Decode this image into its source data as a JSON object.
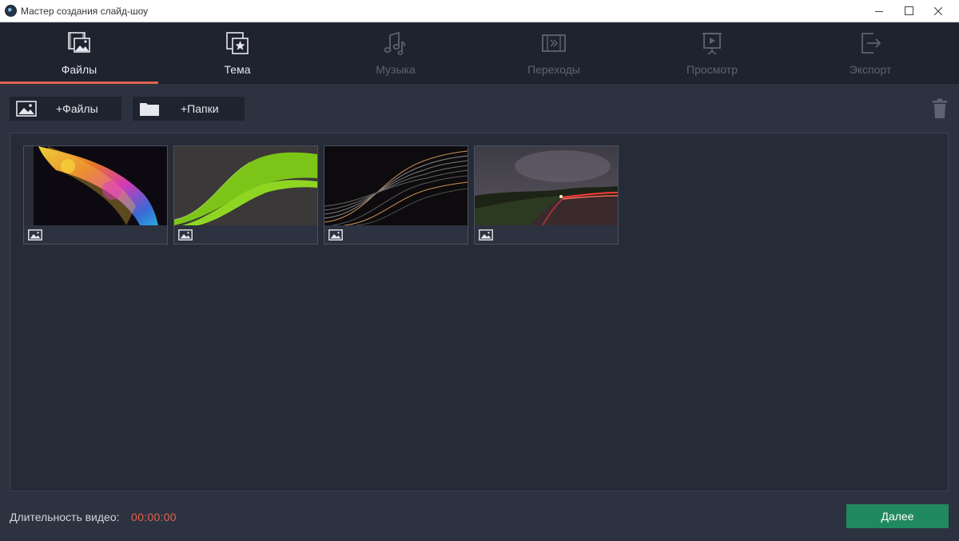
{
  "window": {
    "title": "Мастер создания слайд-шоу",
    "close_glyph": "✕"
  },
  "tabs": [
    {
      "label": "Файлы",
      "icon": "film-image-icon",
      "state": "active"
    },
    {
      "label": "Тема",
      "icon": "theme-star-icon",
      "state": "enabled"
    },
    {
      "label": "Музыка",
      "icon": "music-note-icon",
      "state": "disabled"
    },
    {
      "label": "Переходы",
      "icon": "transitions-icon",
      "state": "disabled"
    },
    {
      "label": "Просмотр",
      "icon": "preview-play-icon",
      "state": "disabled"
    },
    {
      "label": "Экспорт",
      "icon": "export-icon",
      "state": "disabled"
    }
  ],
  "toolbar": {
    "add_files_label": "+Файлы",
    "add_folders_label": "+Папки"
  },
  "media": [
    {
      "type": "image",
      "icon": "image-icon"
    },
    {
      "type": "image",
      "icon": "image-icon"
    },
    {
      "type": "image",
      "icon": "image-icon"
    },
    {
      "type": "image",
      "icon": "image-icon"
    }
  ],
  "footer": {
    "duration_label": "Длительность видео:",
    "duration_value": "00:00:00",
    "next_label": "Далее"
  },
  "colors": {
    "accent": "#e0624e",
    "next_button": "#21895e",
    "tab_bar": "#1f2330",
    "background": "#2d3240"
  }
}
